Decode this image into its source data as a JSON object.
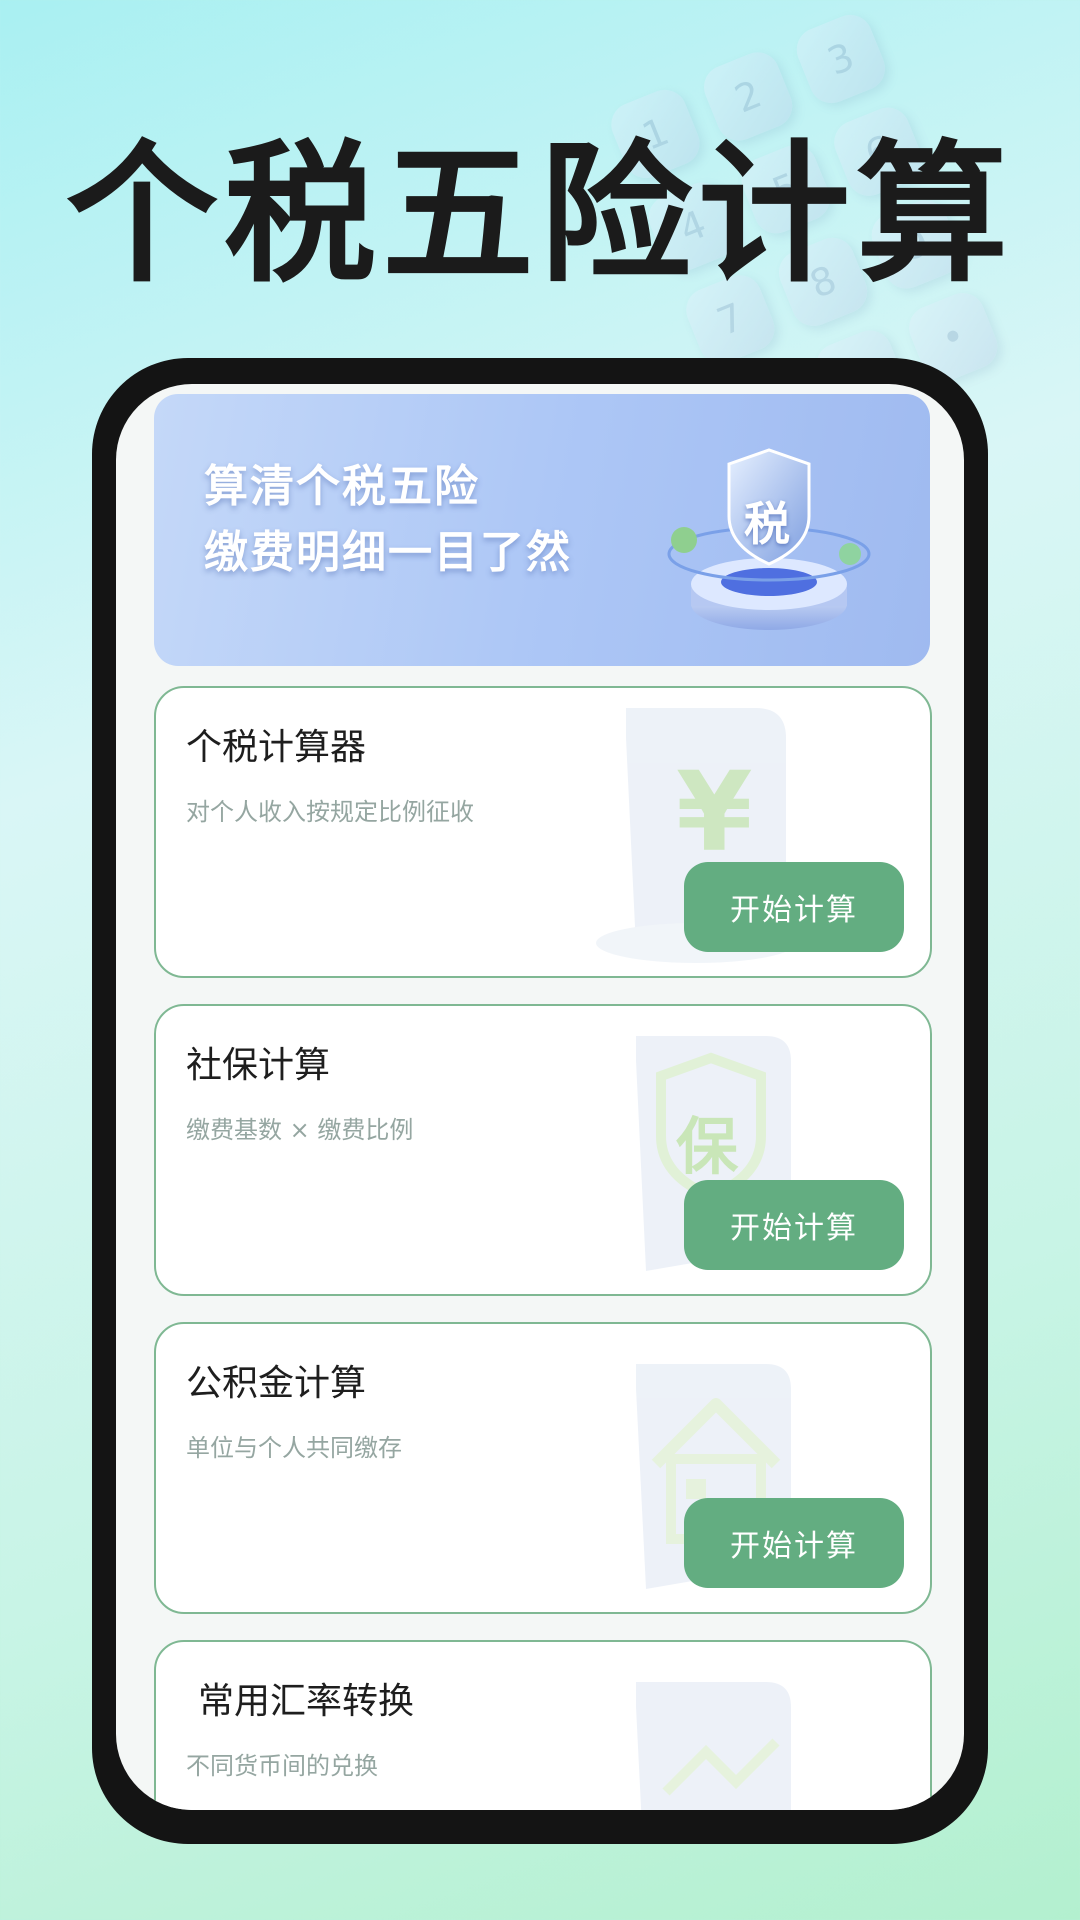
{
  "headline": "个税五险计算",
  "banner": {
    "line1": "算清个税五险",
    "line2": "缴费明细一目了然",
    "badge_char": "税"
  },
  "background_keys": [
    "1",
    "2",
    "3",
    "4",
    "5",
    "6",
    "7",
    "8",
    "9",
    "0",
    "•"
  ],
  "cards": [
    {
      "title": "个税计算器",
      "subtitle": "对个人收入按规定比例征收",
      "button": "开始计算",
      "icon": "yen-icon",
      "icon_char": "¥"
    },
    {
      "title": "社保计算",
      "subtitle": "缴费基数 × 缴费比例",
      "button": "开始计算",
      "icon": "shield-bao-icon",
      "icon_char": "保"
    },
    {
      "title": "公积金计算",
      "subtitle": "单位与个人共同缴存",
      "button": "开始计算",
      "icon": "house-icon",
      "icon_char": ""
    },
    {
      "title": "常用汇率转换",
      "subtitle": "不同货币间的兑换",
      "button": "",
      "icon": "exchange-icon",
      "icon_char": ""
    }
  ],
  "colors": {
    "accent_green": "#63ad81",
    "card_border": "#7fb893",
    "banner_blue": "#adc7f6",
    "phone_frame": "#141414"
  }
}
